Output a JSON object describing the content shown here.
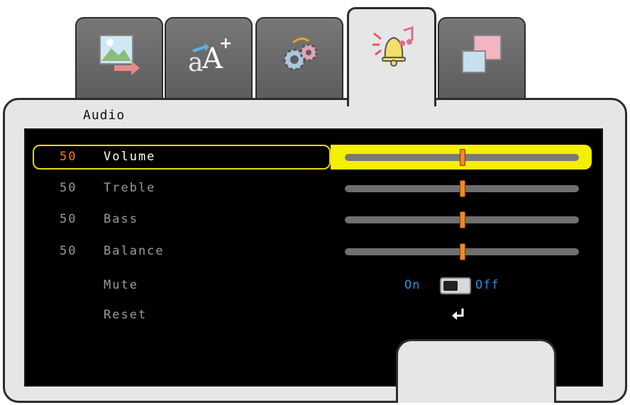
{
  "tabs": [
    {
      "icon": "image-picture-icon",
      "active": false
    },
    {
      "icon": "text-size-icon",
      "active": false
    },
    {
      "icon": "settings-gears-icon",
      "active": false
    },
    {
      "icon": "audio-bell-music-icon",
      "active": true
    },
    {
      "icon": "windows-overlap-icon",
      "active": false
    }
  ],
  "panel": {
    "title": "Audio"
  },
  "rows": [
    {
      "value": "50",
      "label": "Volume",
      "level": 50,
      "selected": true
    },
    {
      "value": "50",
      "label": "Treble",
      "level": 50,
      "selected": false
    },
    {
      "value": "50",
      "label": "Bass",
      "level": 50,
      "selected": false
    },
    {
      "value": "50",
      "label": "Balance",
      "level": 50,
      "selected": false
    }
  ],
  "mute": {
    "label": "Mute",
    "on_label": "On",
    "off_label": "Off",
    "state": "off"
  },
  "reset": {
    "label": "Reset",
    "icon": "enter-return-icon"
  },
  "colors": {
    "highlight": "#f5ef00",
    "selected_value": "#ff7a1a",
    "mute_text": "#2a8cd8",
    "knob": "#f08a1e"
  }
}
